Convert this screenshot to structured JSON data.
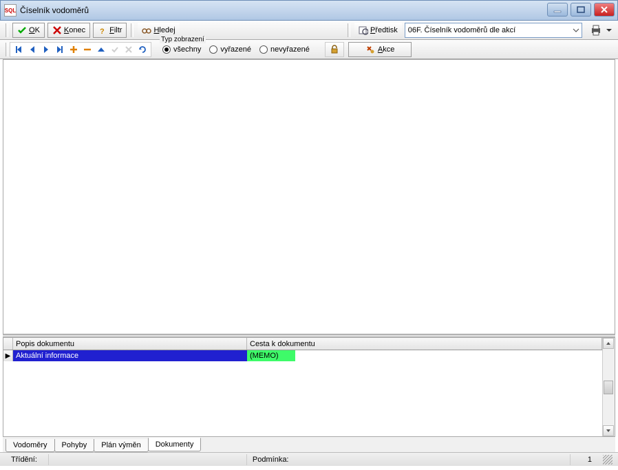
{
  "window": {
    "title": "Číselník vodoměrů",
    "icon_text": "SQL"
  },
  "toolbar1": {
    "ok": "OK",
    "konec": "Konec",
    "filtr": "Filtr",
    "hledej": "Hledej",
    "predtisk": "Předtisk",
    "dropdown_value": "06F. Číselník vodoměrů dle akcí"
  },
  "toolbar2": {
    "typ_label": "Typ zobrazení",
    "radio_vsechny": "všechny",
    "radio_vyrazene": "vyřazené",
    "radio_nevyrazene": "nevyřazené",
    "akce": "Akce"
  },
  "grid": {
    "col1": "Popis dokumentu",
    "col2": "Cesta k dokumentu",
    "row1_col1": "Aktuální informace",
    "row1_col2": "(MEMO)"
  },
  "tabs": {
    "t1": "Vodoměry",
    "t2": "Pohyby",
    "t3": "Plán výměn",
    "t4": "Dokumenty"
  },
  "status": {
    "trideni": "Třídění:",
    "podminka": "Podmínka:",
    "page": "1"
  }
}
